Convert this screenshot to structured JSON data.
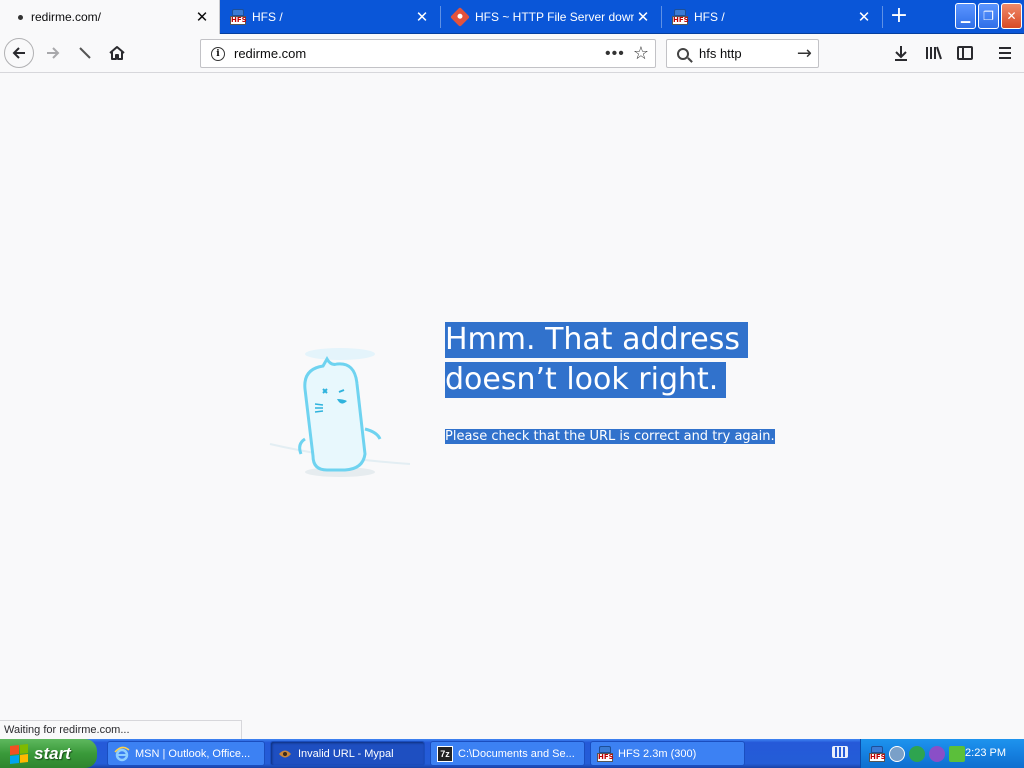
{
  "tabs": [
    {
      "title": "redirme.com/",
      "icon": "loading-dot",
      "active": true
    },
    {
      "title": "HFS /",
      "icon": "hfs-icon",
      "active": false
    },
    {
      "title": "HFS ~ HTTP File Server download",
      "icon": "git-icon",
      "active": false
    },
    {
      "title": "HFS /",
      "icon": "hfs-icon",
      "active": false
    }
  ],
  "tab_close_glyph": "✕",
  "new_tab_glyph": "+",
  "hfs_icon_text": "HFS",
  "window_controls": {
    "minimize": "▁",
    "restore": "❐",
    "close": "✕"
  },
  "navbar": {
    "url": "redirme.com",
    "url_info_glyph": "i",
    "page_actions_glyph": "•••",
    "bookmark_glyph": "☆",
    "search_value": "hfs http",
    "search_go_glyph": "→"
  },
  "error_page": {
    "title_line1": "Hmm. That address",
    "title_line2": "doesn’t look right.",
    "description": "Please check that the URL is correct and try again."
  },
  "status_text": "Waiting for redirme.com...",
  "taskbar": {
    "start_label": "start",
    "tasks": [
      {
        "label": "MSN | Outlook, Office...",
        "icon": "ie-icon",
        "active": false
      },
      {
        "label": "Invalid URL - Mypal",
        "icon": "mypal-icon",
        "active": true
      },
      {
        "label": "C:\\Documents and Se...",
        "icon": "7zip-icon",
        "active": false
      },
      {
        "label": "HFS 2.3m (300)",
        "icon": "hfs-icon",
        "active": false
      }
    ],
    "seven_zip_text": "7z",
    "clock": "2:23 PM"
  },
  "colors": {
    "tabstrip": "#0a56d8",
    "selection": "#3172cc",
    "page_bg": "#f9f9fa",
    "taskbar": "#245dd7",
    "start_green": "#3a9a3a"
  }
}
